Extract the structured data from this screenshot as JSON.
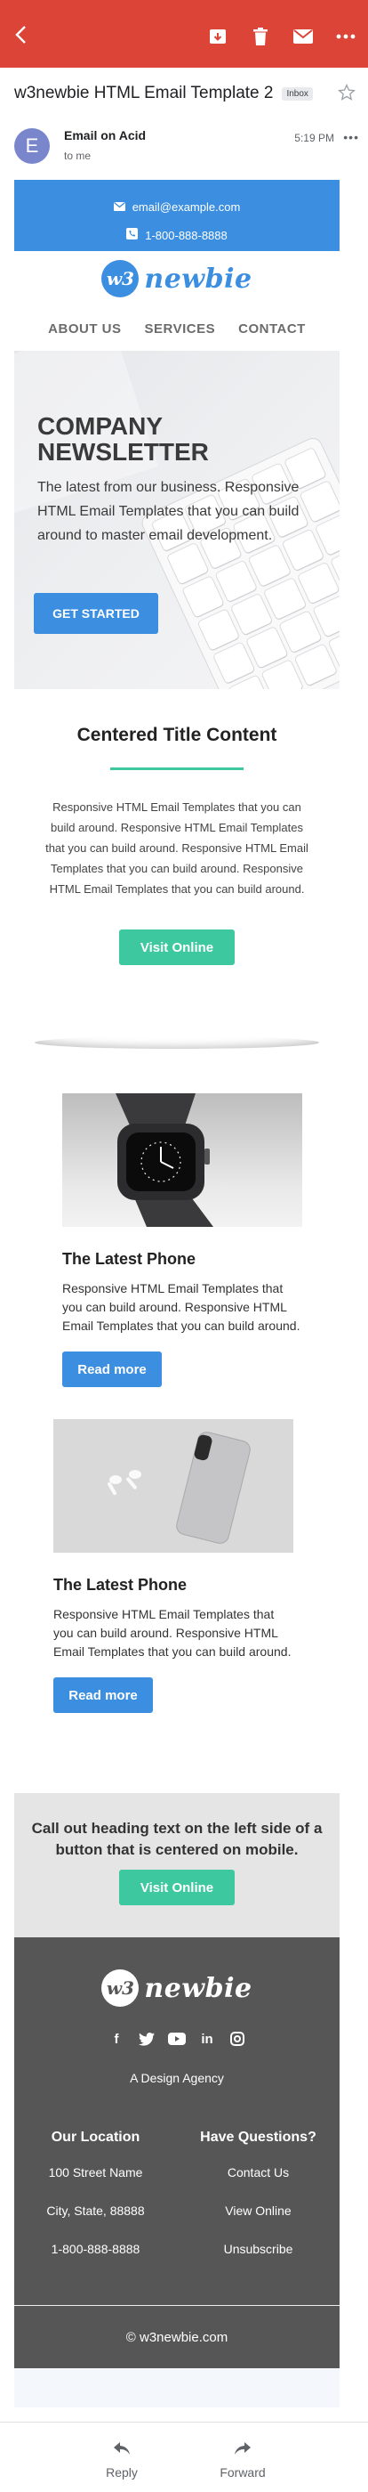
{
  "colors": {
    "appbar": "#db4437",
    "accent_blue": "#3b8ee0",
    "accent_green": "#3ec8a0",
    "footer": "#565656"
  },
  "appbar": {
    "icons": [
      "back-arrow-icon",
      "archive-icon",
      "trash-icon",
      "mail-icon",
      "more-icon"
    ]
  },
  "email": {
    "subject": "w3newbie HTML Email Template 2",
    "label": "Inbox",
    "sender_initial": "E",
    "sender_name": "Email on Acid",
    "to": "to me",
    "time": "5:19 PM"
  },
  "template": {
    "contact": {
      "email": "email@example.com",
      "phone": "1-800-888-8888"
    },
    "logo": {
      "mark": "w3",
      "text": "newbie"
    },
    "nav": [
      "ABOUT US",
      "SERVICES",
      "CONTACT"
    ],
    "hero": {
      "title_line1": "COMPANY",
      "title_line2": "NEWSLETTER",
      "text": "The latest from our business. Responsive HTML Email Templates that you can build around to master email development.",
      "button": "GET STARTED"
    },
    "centered": {
      "title": "Centered Title Content",
      "text": "Responsive HTML Email Templates that you can build around. Responsive HTML Email Templates that you can build around. Responsive HTML Email Templates that you can build around. Responsive HTML Email Templates that you can build around.",
      "button": "Visit Online"
    },
    "cards": [
      {
        "title": "The Latest Phone",
        "text": "Responsive HTML Email Templates that you can build around. Responsive HTML Email Templates that you can build around.",
        "button": "Read more"
      },
      {
        "title": "The Latest Phone",
        "text": "Responsive HTML Email Templates that you can build around. Responsive HTML Email Templates that you can build around.",
        "button": "Read more"
      }
    ],
    "callout": {
      "text": "Call out heading text on the left side of a button that is centered on mobile.",
      "button": "Visit Online"
    },
    "footer": {
      "social": [
        "f",
        "in"
      ],
      "tagline": "A Design Agency",
      "col1": {
        "heading": "Our Location",
        "lines": [
          "100 Street Name",
          "City, State, 88888",
          "1-800-888-8888"
        ]
      },
      "col2": {
        "heading": "Have Questions?",
        "lines": [
          "Contact Us",
          "View Online",
          "Unsubscribe"
        ]
      },
      "copyright": "© w3newbie.com"
    }
  },
  "bottombar": {
    "reply": "Reply",
    "forward": "Forward"
  }
}
